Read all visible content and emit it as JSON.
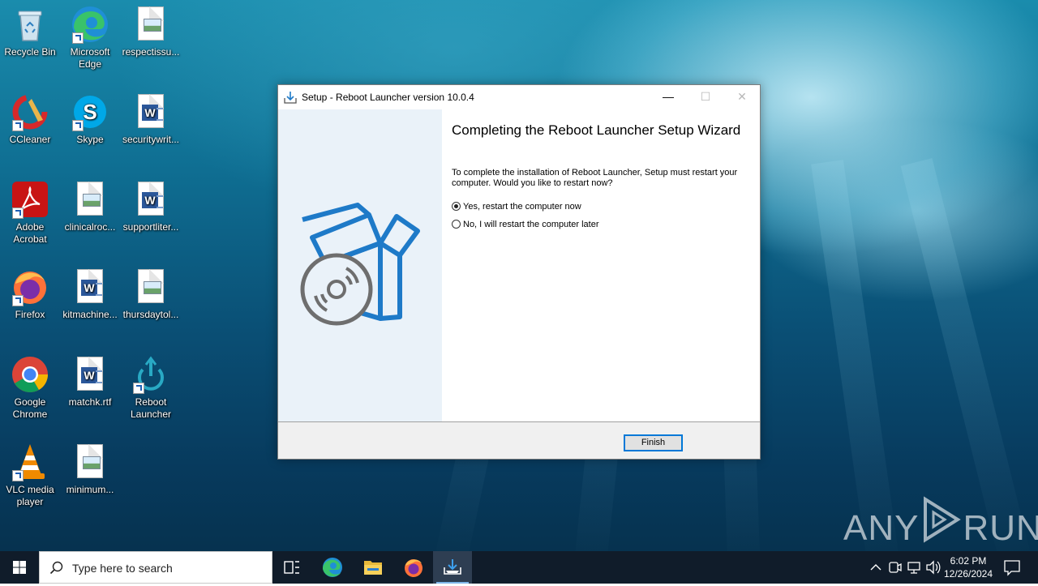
{
  "desktop": {
    "icons": [
      {
        "label": "Recycle Bin"
      },
      {
        "label": "Microsoft Edge"
      },
      {
        "label": "respectissu..."
      },
      {
        "label": "CCleaner"
      },
      {
        "label": "Skype"
      },
      {
        "label": "securitywrit..."
      },
      {
        "label": "Adobe Acrobat"
      },
      {
        "label": "clinicalroc..."
      },
      {
        "label": "supportliter..."
      },
      {
        "label": "Firefox"
      },
      {
        "label": "kitmachine..."
      },
      {
        "label": "thursdaytol..."
      },
      {
        "label": "Google Chrome"
      },
      {
        "label": "matchk.rtf"
      },
      {
        "label": "Reboot Launcher"
      },
      {
        "label": "VLC media player"
      },
      {
        "label": "minimum..."
      }
    ]
  },
  "dialog": {
    "title": "Setup - Reboot Launcher version 10.0.4",
    "minimize_glyph": "—",
    "maximize_glyph": "☐",
    "close_glyph": "✕",
    "heading": "Completing the Reboot Launcher Setup Wizard",
    "body": "To complete the installation of Reboot Launcher, Setup must restart your computer. Would you like to restart now?",
    "options": [
      {
        "label": "Yes, restart the computer now",
        "selected": true
      },
      {
        "label": "No, I will restart the computer later",
        "selected": false
      }
    ],
    "finish_label": "Finish"
  },
  "watermark": {
    "left": "ANY",
    "right": "RUN"
  },
  "taskbar": {
    "search_placeholder": "Type here to search",
    "time": "6:02 PM",
    "date": "12/26/2024",
    "apps": [
      "task-view",
      "microsoft-edge",
      "file-explorer",
      "firefox",
      "setup-installer"
    ]
  },
  "colors": {
    "accent": "#0078d7",
    "taskbar": "#101c2a",
    "wizard_left_panel": "#eaf2f9",
    "installer_icon": "#1e7ac8"
  }
}
